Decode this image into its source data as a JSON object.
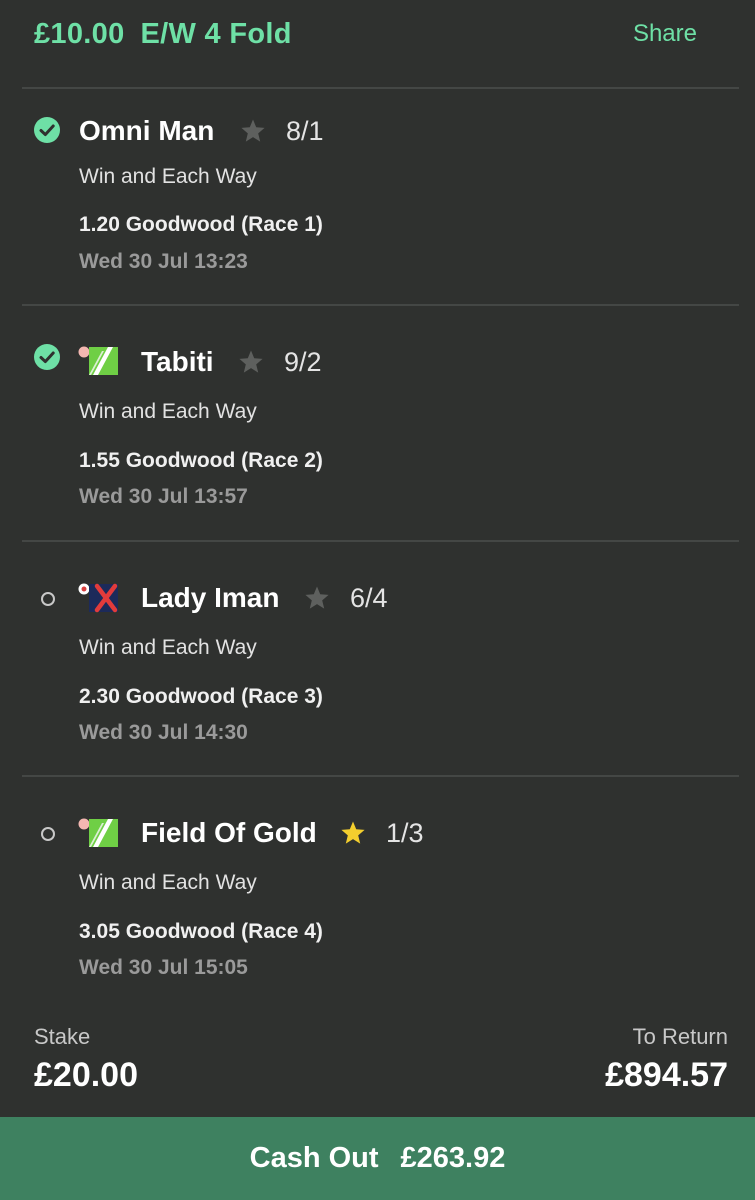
{
  "header": {
    "stake": "£10.00",
    "bet_type": "E/W 4 Fold",
    "share_label": "Share"
  },
  "selections": [
    {
      "status": "won",
      "has_silk": false,
      "silk": "",
      "runner": "Omni Man",
      "favourite": false,
      "odds": "8/1",
      "market": "Win and Each Way",
      "race": "1.20 Goodwood (Race 1)",
      "time": "Wed 30 Jul 13:23"
    },
    {
      "status": "won",
      "has_silk": true,
      "silk": "white-green-diagonal-silk-icon",
      "runner": "Tabiti",
      "favourite": false,
      "odds": "9/2",
      "market": "Win and Each Way",
      "race": "1.55 Goodwood (Race 2)",
      "time": "Wed 30 Jul 13:57"
    },
    {
      "status": "open",
      "has_silk": true,
      "silk": "navy-red-cross-silk-icon",
      "runner": "Lady Iman",
      "favourite": false,
      "odds": "6/4",
      "market": "Win and Each Way",
      "race": "2.30 Goodwood (Race 3)",
      "time": "Wed 30 Jul 14:30"
    },
    {
      "status": "open",
      "has_silk": true,
      "silk": "white-green-diagonal-silk-icon",
      "runner": "Field Of Gold",
      "favourite": true,
      "odds": "1/3",
      "market": "Win and Each Way",
      "race": "3.05 Goodwood (Race 4)",
      "time": "Wed 30 Jul 15:05"
    }
  ],
  "footer": {
    "stake_label": "Stake",
    "stake_value": "£20.00",
    "return_label": "To Return",
    "return_value": "£894.57"
  },
  "cashout": {
    "label": "Cash Out",
    "amount": "£263.92"
  },
  "colors": {
    "accent_green": "#6ee0a6",
    "cashout_green": "#3e8160",
    "card_bg": "#2f312f",
    "star_grey": "#5e605e",
    "star_gold": "#f4cf2e"
  }
}
